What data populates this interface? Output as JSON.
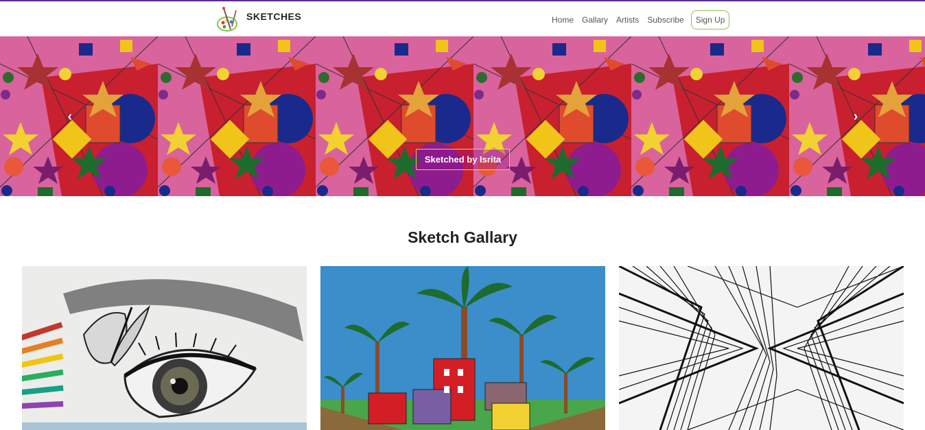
{
  "brand": {
    "name": "SKETCHES",
    "logo_icon": "palette-icon"
  },
  "nav": {
    "links": [
      {
        "label": "Home"
      },
      {
        "label": "Gallary"
      },
      {
        "label": "Artists"
      },
      {
        "label": "Subscribe"
      }
    ],
    "signup_label": "Sign Up"
  },
  "carousel": {
    "caption": "Sketched by Isrita",
    "prev_icon": "chevron-left-icon",
    "next_icon": "chevron-right-icon",
    "tile_count": 6
  },
  "gallery": {
    "title": "Sketch Gallary",
    "items": [
      {
        "alt": "pencil eye and butterfly sketch"
      },
      {
        "alt": "palm trees and buildings painting"
      },
      {
        "alt": "black and white zentangle pattern"
      }
    ]
  },
  "colors": {
    "accent_purple": "#5b2d8e",
    "signup_border": "#8bc34a",
    "caption_border": "#e8d046"
  }
}
